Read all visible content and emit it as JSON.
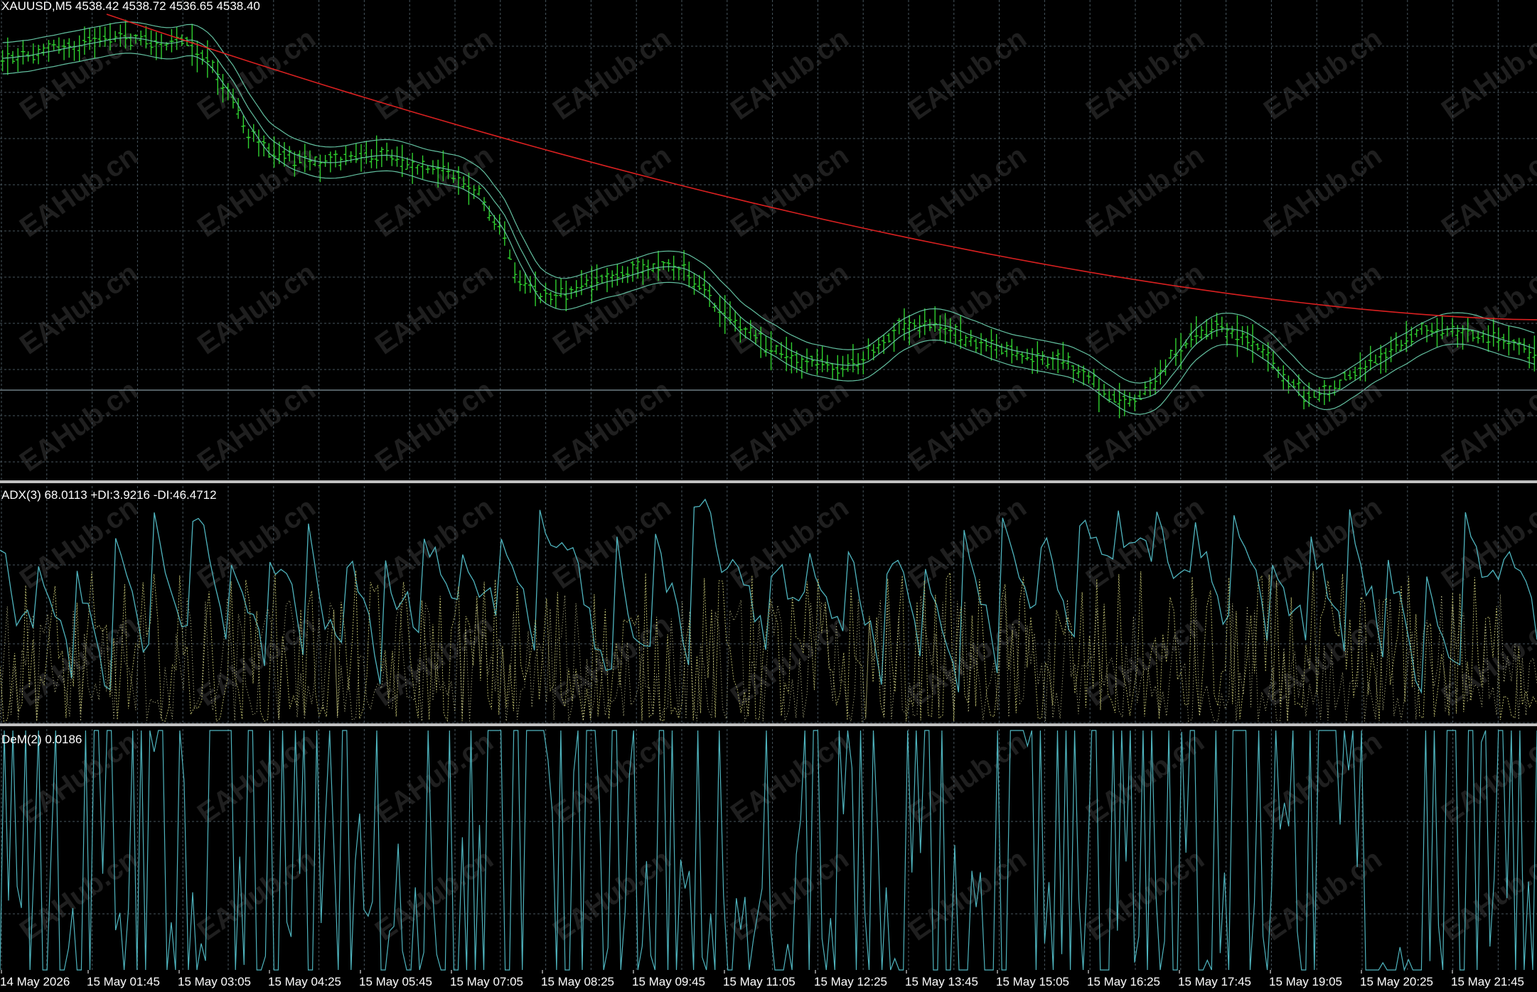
{
  "colors": {
    "background": "#000000",
    "grid": "#48565e",
    "separator": "#c0c0c0",
    "candle": "#2fd12f",
    "envelope": "#63c0a0",
    "long_ma": "#d92020",
    "adx_line": "#4fb5bf",
    "di_plus": "#b5b56a",
    "di_minus": "#d8d8a0",
    "dem_line": "#4fb5bf",
    "text": "#ffffff",
    "watermark": "#3a3a3a"
  },
  "watermark": "EAHub.cn",
  "panes": {
    "price": {
      "header": "XAUUSD,M5  4538.42 4538.72 4536.65 4538.40"
    },
    "adx": {
      "header": "ADX(3) 68.0113 +DI:3.9216 -DI:46.4712"
    },
    "dem": {
      "header": "DeM(2) 0.0186"
    }
  },
  "chart_data": [
    {
      "type": "candlestick",
      "pane": "price",
      "symbol": "XAUUSD",
      "timeframe": "M5",
      "last_bar": {
        "open": 4538.42,
        "high": 4538.72,
        "low": 4536.65,
        "close": 4538.4
      },
      "price_path_shape": [
        0.1,
        0.09,
        0.08,
        0.07,
        0.06,
        0.05,
        0.06,
        0.07,
        0.05,
        0.1,
        0.18,
        0.27,
        0.31,
        0.33,
        0.34,
        0.33,
        0.32,
        0.32,
        0.34,
        0.35,
        0.36,
        0.4,
        0.48,
        0.6,
        0.64,
        0.63,
        0.61,
        0.6,
        0.58,
        0.57,
        0.58,
        0.62,
        0.68,
        0.72,
        0.75,
        0.78,
        0.79,
        0.8,
        0.79,
        0.74,
        0.71,
        0.7,
        0.72,
        0.74,
        0.76,
        0.77,
        0.78,
        0.79,
        0.82,
        0.86,
        0.88,
        0.85,
        0.77,
        0.72,
        0.71,
        0.73,
        0.77,
        0.83,
        0.87,
        0.85,
        0.81,
        0.78,
        0.75,
        0.72,
        0.71,
        0.72,
        0.74,
        0.75,
        0.77
      ],
      "indicators": [
        "Envelopes around moving average",
        "Long-period moving average (red)"
      ]
    },
    {
      "type": "line",
      "pane": "adx",
      "title": "ADX(3) 68.0113 +DI:3.9216 -DI:46.4712",
      "series": [
        {
          "name": "ADX(3)",
          "last": 68.0113
        },
        {
          "name": "+DI",
          "last": 3.9216
        },
        {
          "name": "-DI",
          "last": 46.4712
        }
      ]
    },
    {
      "type": "line",
      "pane": "dem",
      "title": "DeM(2) 0.0186",
      "series": [
        {
          "name": "DeM(2)",
          "last": 0.0186
        }
      ]
    }
  ],
  "x_axis": {
    "ticks": [
      "14 May 2026",
      "15 May 01:45",
      "15 May 03:05",
      "15 May 04:25",
      "15 May 05:45",
      "15 May 07:05",
      "15 May 08:25",
      "15 May 09:45",
      "15 May 11:05",
      "15 May 12:25",
      "15 May 13:45",
      "15 May 15:05",
      "15 May 16:25",
      "15 May 17:45",
      "15 May 19:05",
      "15 May 20:25",
      "15 May 21:45"
    ]
  }
}
